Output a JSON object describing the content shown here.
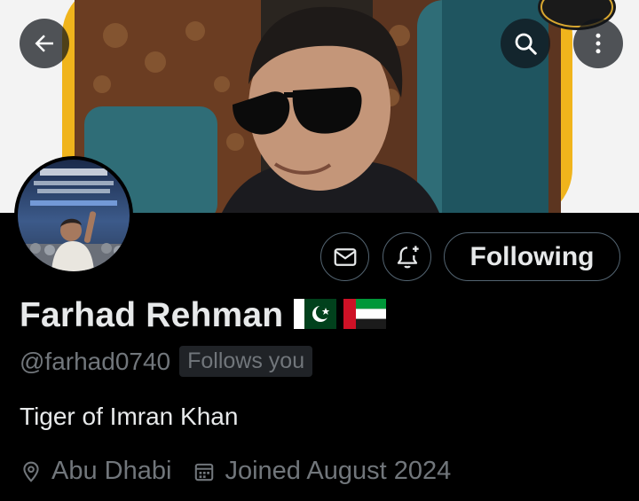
{
  "header": {
    "back_icon": "arrow-left-icon",
    "search_icon": "search-icon",
    "more_icon": "more-vertical-icon"
  },
  "actions": {
    "message_icon": "envelope-icon",
    "notify_icon": "bell-plus-icon",
    "follow_label": "Following"
  },
  "profile": {
    "display_name": "Farhad Rehman",
    "flags": [
      "pakistan-flag",
      "uae-flag"
    ],
    "handle": "@farhad0740",
    "follows_badge": "Follows you",
    "bio": "Tiger of Imran Khan",
    "location": "Abu Dhabi",
    "location_icon": "location-pin-icon",
    "joined": "Joined August 2024",
    "joined_icon": "calendar-icon"
  },
  "colors": {
    "background": "#000000",
    "primary_text": "#e7e9ea",
    "secondary_text": "#71767b",
    "border": "#536471",
    "badge_bg": "#202327",
    "banner_frame": "#f0b41c",
    "banner_chair": "#2f6d77"
  }
}
